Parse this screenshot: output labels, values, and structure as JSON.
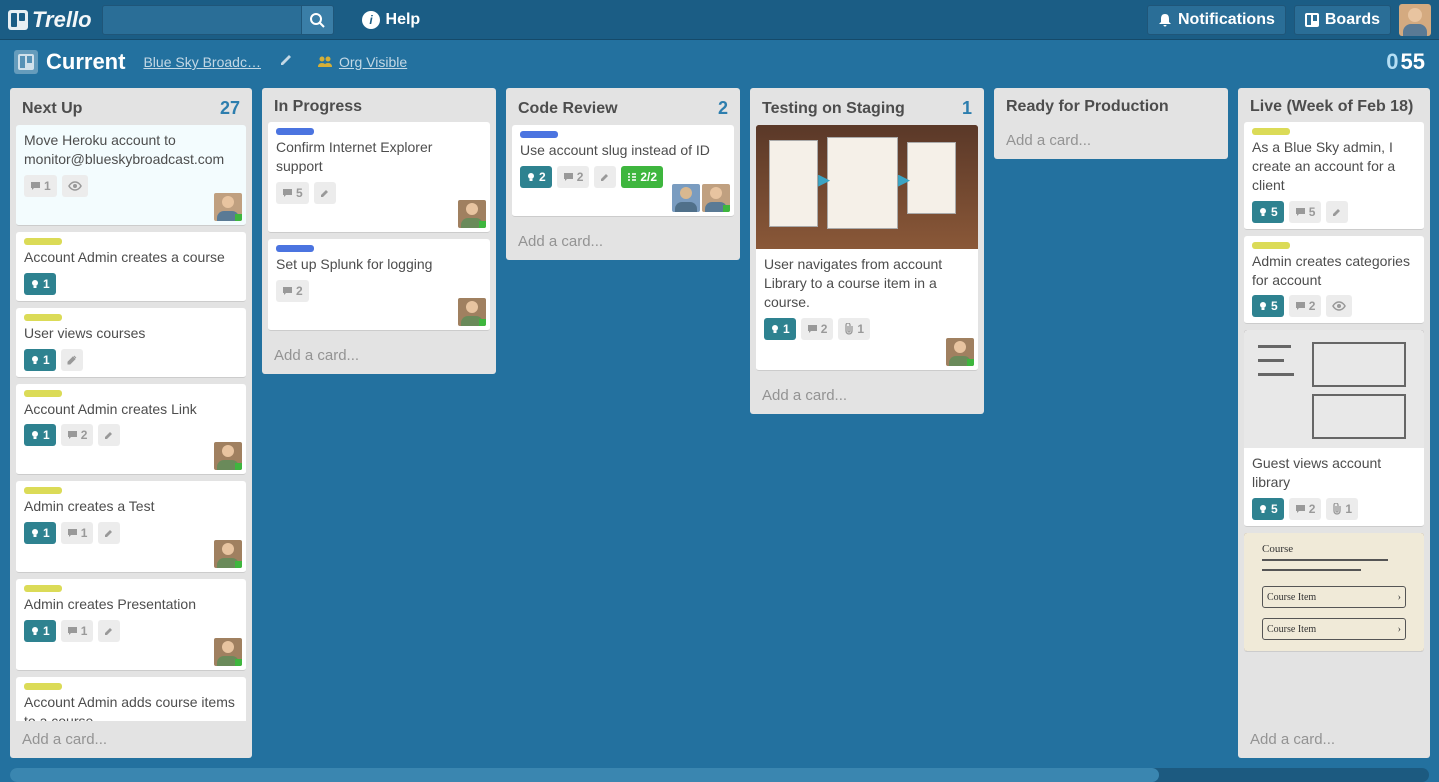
{
  "header": {
    "logo": "Trello",
    "help": "Help",
    "notifications": "Notifications",
    "boards": "Boards"
  },
  "board": {
    "title": "Current",
    "org": "Blue Sky Broadc…",
    "visibility": "Org Visible",
    "count_done": "0",
    "count_total": "55"
  },
  "lists": {
    "next_up": {
      "title": "Next Up",
      "count": "27",
      "add": "Add a card..."
    },
    "in_progress": {
      "title": "In Progress",
      "add": "Add a card..."
    },
    "code_review": {
      "title": "Code Review",
      "count": "2",
      "add": "Add a card..."
    },
    "testing": {
      "title": "Testing on Staging",
      "count": "1",
      "add": "Add a card..."
    },
    "ready": {
      "title": "Ready for Production",
      "add": "Add a card..."
    },
    "live": {
      "title": "Live (Week of Feb 18)",
      "add": "Add a card..."
    }
  },
  "cards": {
    "nu1": {
      "title": "Move Heroku account to monitor@blueskybroadcast.com",
      "comments": "1"
    },
    "nu2": {
      "title": "Account Admin creates a course",
      "votes": "1"
    },
    "nu3": {
      "title": "User views courses",
      "votes": "1"
    },
    "nu4": {
      "title": "Account Admin creates Link",
      "votes": "1",
      "comments": "2"
    },
    "nu5": {
      "title": "Admin creates a Test",
      "votes": "1",
      "comments": "1"
    },
    "nu6": {
      "title": "Admin creates Presentation",
      "votes": "1",
      "comments": "1"
    },
    "nu7": {
      "title": "Account Admin adds course items to a course"
    },
    "ip1": {
      "title": "Confirm Internet Explorer support",
      "comments": "5"
    },
    "ip2": {
      "title": "Set up Splunk for logging",
      "comments": "2"
    },
    "cr1": {
      "title": "Use account slug instead of ID",
      "votes": "2",
      "comments": "2",
      "check": "2/2"
    },
    "ts1": {
      "title": "User navigates from account Library to a course item in a course.",
      "votes": "1",
      "comments": "2",
      "attach": "1"
    },
    "lv1": {
      "title": "As a Blue Sky admin, I create an account for a client",
      "votes": "5",
      "comments": "5"
    },
    "lv2": {
      "title": "Admin creates categories for account",
      "votes": "5",
      "comments": "2"
    },
    "lv3": {
      "title": "Guest views account library",
      "votes": "5",
      "comments": "2",
      "attach": "1"
    }
  },
  "hscroll_thumb_width": "81%"
}
